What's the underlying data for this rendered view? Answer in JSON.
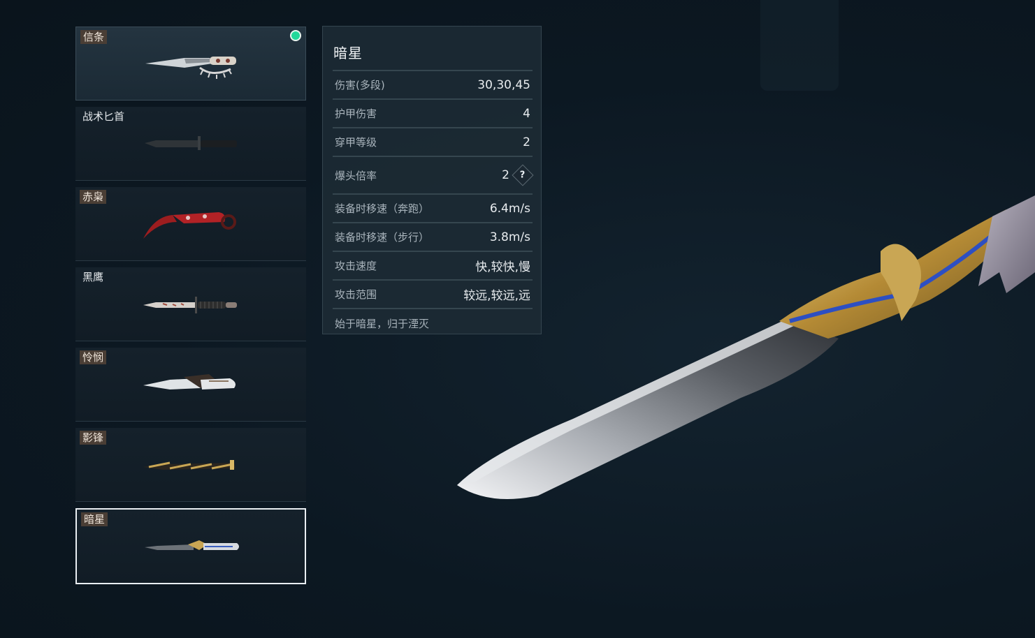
{
  "knives": [
    {
      "name": "信条",
      "tagged": true,
      "equipped": true,
      "selected": false
    },
    {
      "name": "战术匕首",
      "tagged": false,
      "equipped": false,
      "selected": false
    },
    {
      "name": "赤枭",
      "tagged": true,
      "equipped": false,
      "selected": false
    },
    {
      "name": "黑鹰",
      "tagged": false,
      "equipped": false,
      "selected": false
    },
    {
      "name": "怜悯",
      "tagged": true,
      "equipped": false,
      "selected": false
    },
    {
      "name": "影锋",
      "tagged": true,
      "equipped": false,
      "selected": false
    },
    {
      "name": "暗星",
      "tagged": true,
      "equipped": false,
      "selected": true
    }
  ],
  "stats": {
    "title": "暗星",
    "rows": [
      {
        "label": "伤害(多段)",
        "value": "30,30,45"
      },
      {
        "label": "护甲伤害",
        "value": "4"
      },
      {
        "label": "穿甲等级",
        "value": "2"
      },
      {
        "label": "爆头倍率",
        "value": "2",
        "help": "?"
      },
      {
        "label": "装备时移速（奔跑）",
        "value": "6.4m/s"
      },
      {
        "label": "装备时移速（步行）",
        "value": "3.8m/s"
      },
      {
        "label": "攻击速度",
        "value": "快,较快,慢"
      },
      {
        "label": "攻击范围",
        "value": "较远,较远,远"
      }
    ],
    "flavor": "始于暗星，归于湮灭"
  },
  "colors": {
    "equipped_dot": "#22d89a",
    "selected_border": "#e9eef2",
    "tag_bg": "#4a3e35"
  }
}
